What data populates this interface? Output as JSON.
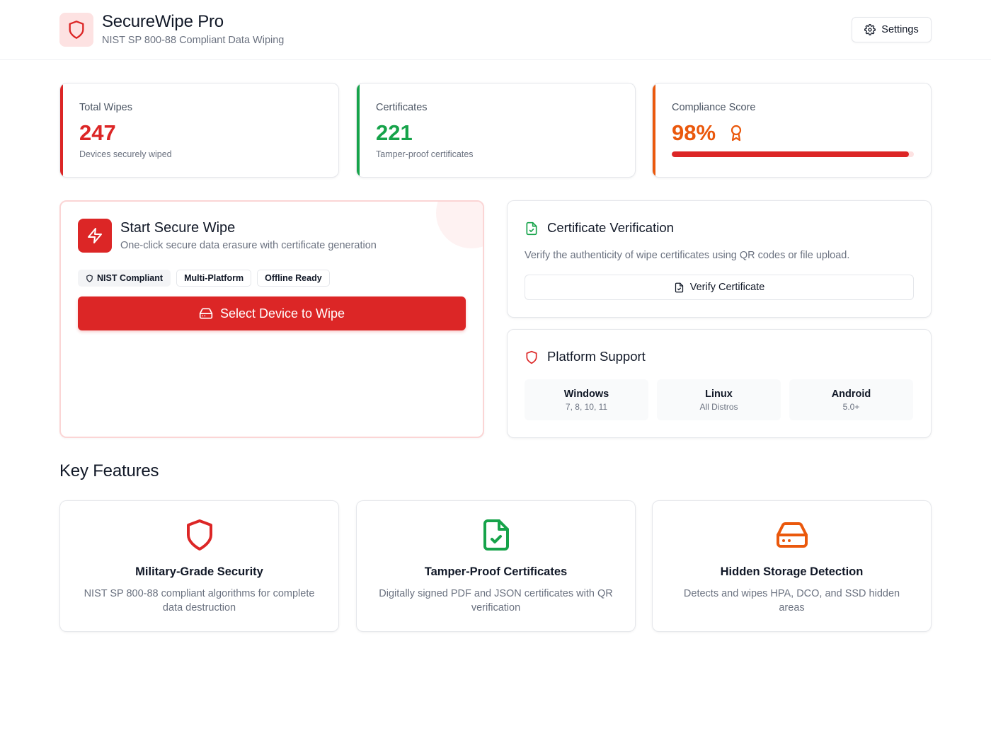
{
  "header": {
    "title": "SecureWipe Pro",
    "subtitle": "NIST SP 800-88 Compliant Data Wiping",
    "settings_label": "Settings"
  },
  "stats": {
    "total_wipes": {
      "label": "Total Wipes",
      "value": "247",
      "desc": "Devices securely wiped",
      "accent": "#dc2626"
    },
    "certificates": {
      "label": "Certificates",
      "value": "221",
      "desc": "Tamper-proof certificates",
      "accent": "#16a34a"
    },
    "compliance": {
      "label": "Compliance Score",
      "value": "98%",
      "progress_percent": 98,
      "accent": "#ea580c"
    }
  },
  "wipe": {
    "title": "Start Secure Wipe",
    "subtitle": "One-click secure data erasure with certificate generation",
    "badges": [
      "NIST Compliant",
      "Multi-Platform",
      "Offline Ready"
    ],
    "button_label": "Select Device to Wipe"
  },
  "verification": {
    "title": "Certificate Verification",
    "description": "Verify the authenticity of wipe certificates using QR codes or file upload.",
    "button_label": "Verify Certificate"
  },
  "platform_support": {
    "title": "Platform Support",
    "platforms": [
      {
        "name": "Windows",
        "versions": "7, 8, 10, 11"
      },
      {
        "name": "Linux",
        "versions": "All Distros"
      },
      {
        "name": "Android",
        "versions": "5.0+"
      }
    ]
  },
  "features": {
    "title": "Key Features",
    "items": [
      {
        "icon": "shield-icon",
        "title": "Military-Grade Security",
        "desc": "NIST SP 800-88 compliant algorithms for complete data destruction"
      },
      {
        "icon": "file-check-icon",
        "title": "Tamper-Proof Certificates",
        "desc": "Digitally signed PDF and JSON certificates with QR verification"
      },
      {
        "icon": "hard-drive-icon",
        "title": "Hidden Storage Detection",
        "desc": "Detects and wipes HPA, DCO, and SSD hidden areas"
      }
    ]
  },
  "colors": {
    "primary": "#dc2626",
    "success": "#16a34a",
    "warning": "#ea580c"
  }
}
